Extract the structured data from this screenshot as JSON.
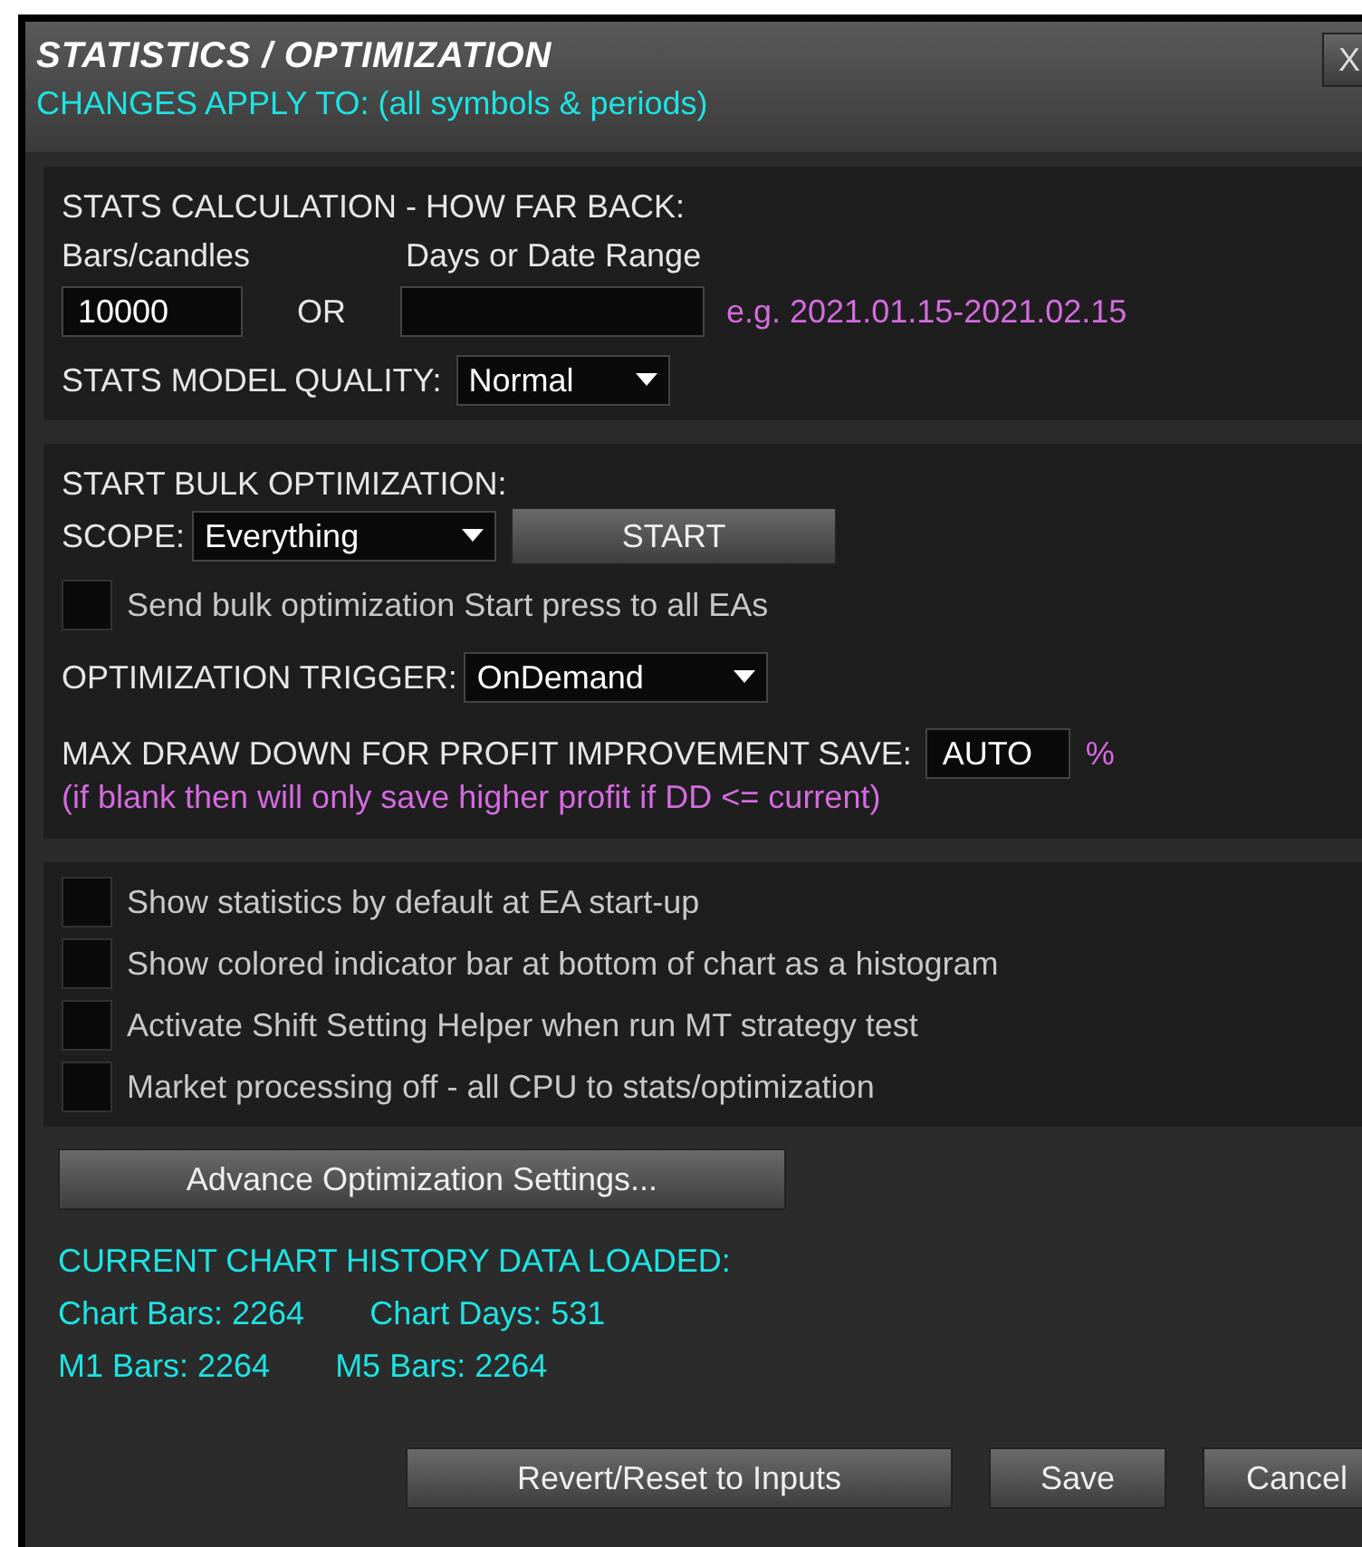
{
  "window": {
    "title": "STATISTICS / OPTIMIZATION",
    "close": "X",
    "subtitle": "CHANGES APPLY TO: (all symbols & periods)"
  },
  "stats_calc": {
    "heading": "STATS CALCULATION - HOW FAR BACK:",
    "bars_label": "Bars/candles",
    "bars_value": "10000",
    "or": "OR",
    "days_label": "Days or Date Range",
    "days_hint": "e.g. 2021.01.15-2021.02.15",
    "quality_label": "STATS MODEL QUALITY:",
    "quality_value": "Normal"
  },
  "bulk": {
    "heading": "START BULK OPTIMIZATION:",
    "scope_label": "SCOPE:",
    "scope_value": "Everything",
    "start_button": "START",
    "send_all": {
      "label": "Send bulk optimization Start press to all EAs",
      "checked": false
    },
    "trigger_label": "OPTIMIZATION TRIGGER:",
    "trigger_value": "OnDemand",
    "max_dd_label": "MAX DRAW DOWN FOR PROFIT IMPROVEMENT SAVE:",
    "max_dd_value": "AUTO",
    "max_dd_unit": "%",
    "note": "(if blank then will only save higher profit if DD <= current)"
  },
  "options": [
    {
      "label": "Show statistics by default at EA start-up",
      "checked": false
    },
    {
      "label": "Show colored indicator bar at bottom of chart as a histogram",
      "checked": false
    },
    {
      "label": "Activate Shift Setting Helper when run MT strategy test",
      "checked": false
    },
    {
      "label": "Market processing off - all CPU to stats/optimization",
      "checked": false
    }
  ],
  "advance_button": "Advance Optimization Settings...",
  "history": {
    "heading": "CURRENT CHART HISTORY DATA LOADED:",
    "rows": [
      [
        "Chart Bars: 2264",
        "Chart Days: 531"
      ],
      [
        "M1 Bars: 2264",
        "M5 Bars: 2264"
      ]
    ]
  },
  "buttons": [
    "Revert/Reset to Inputs",
    "Save",
    "Cancel"
  ]
}
